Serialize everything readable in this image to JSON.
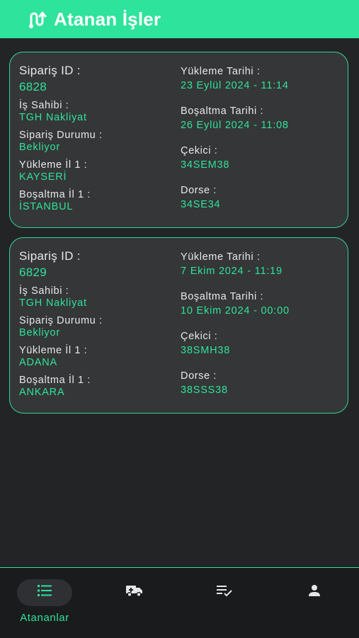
{
  "header": {
    "title": "Atanan İşler",
    "icon": "route-icon"
  },
  "orders": [
    {
      "id_label": "Sipariş ID :",
      "id": "6828",
      "owner_label": "İş Sahibi :",
      "owner": "TGH Nakliyat",
      "status_label": "Sipariş Durumu :",
      "status": "Bekliyor",
      "load_city_label": "Yükleme İl 1 :",
      "load_city": "KAYSERİ",
      "unload_city_label": "Boşaltma İl 1 :",
      "unload_city": "İSTANBUL",
      "load_date_label": "Yükleme Tarihi :",
      "load_date": "23 Eylül 2024 - 11:14",
      "unload_date_label": "Boşaltma Tarihi :",
      "unload_date": "26 Eylül 2024 - 11:08",
      "tractor_label": "Çekici :",
      "tractor": "34SEM38",
      "trailer_label": "Dorse :",
      "trailer": "34SE34"
    },
    {
      "id_label": "Sipariş ID :",
      "id": "6829",
      "owner_label": "İş Sahibi :",
      "owner": "TGH Nakliyat",
      "status_label": "Sipariş Durumu :",
      "status": "Bekliyor",
      "load_city_label": "Yükleme İl 1 :",
      "load_city": "ADANA",
      "unload_city_label": "Boşaltma İl 1 :",
      "unload_city": "ANKARA",
      "load_date_label": "Yükleme Tarihi :",
      "load_date": "7 Ekim 2024 - 11:19",
      "unload_date_label": "Boşaltma Tarihi :",
      "unload_date": "10 Ekim 2024 - 00:00",
      "tractor_label": "Çekici :",
      "tractor": "38SMH38",
      "trailer_label": "Dorse :",
      "trailer": "38SSS38"
    }
  ],
  "nav": {
    "items": [
      {
        "label": "Atananlar",
        "icon": "list-icon",
        "active": true
      },
      {
        "label": "",
        "icon": "truck-icon",
        "active": false
      },
      {
        "label": "",
        "icon": "checklist-icon",
        "active": false
      },
      {
        "label": "",
        "icon": "person-icon",
        "active": false
      }
    ]
  },
  "colors": {
    "accent": "#2ee39b",
    "background": "#232426",
    "card": "#353637"
  }
}
